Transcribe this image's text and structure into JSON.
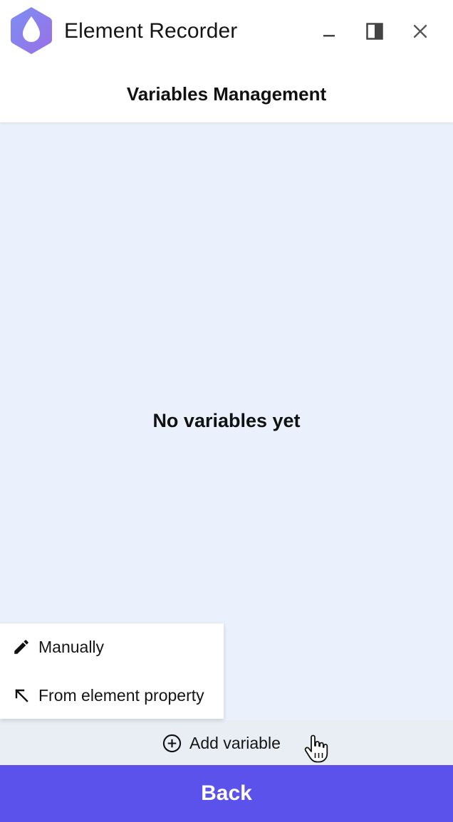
{
  "window": {
    "title": "Element Recorder",
    "logo_icon": "water-drop-hexagon-icon"
  },
  "header": {
    "title": "Variables Management"
  },
  "content": {
    "empty_message": "No variables yet"
  },
  "menu": {
    "items": [
      {
        "label": "Manually",
        "icon": "pencil-icon"
      },
      {
        "label": "From element property",
        "icon": "arrow-up-left-icon"
      }
    ]
  },
  "add_variable": {
    "label": "Add variable",
    "icon": "plus-circle-icon"
  },
  "footer": {
    "back_label": "Back"
  },
  "colors": {
    "accent": "#5b52eb",
    "content_background": "#eaf1fd",
    "logo_gradient_start": "#7b8ff2",
    "logo_gradient_end": "#9b6fe6"
  }
}
